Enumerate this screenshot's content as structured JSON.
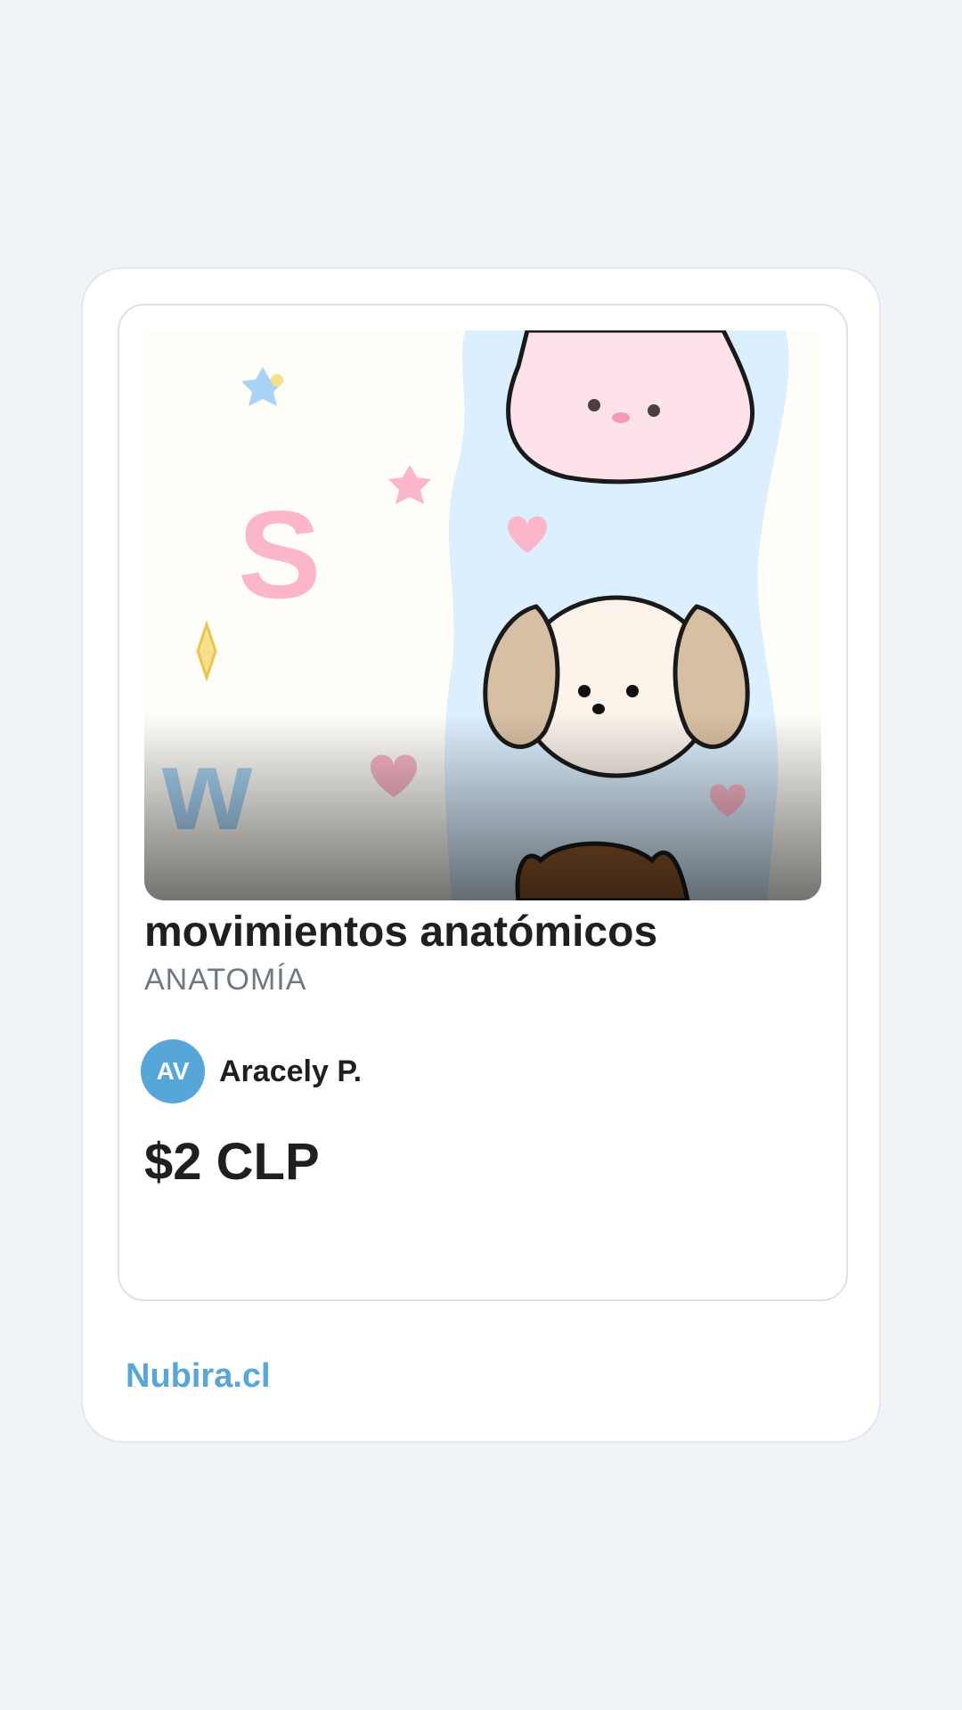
{
  "product": {
    "title": "movimientos anatómicos",
    "category": "ANATOMÍA",
    "price": "$2 CLP",
    "image_icon": "cute-animals-illustration"
  },
  "seller": {
    "initials": "AV",
    "name": "Aracely P."
  },
  "footer": {
    "brand": "Nubira.cl"
  },
  "colors": {
    "background": "#f0f4f8",
    "accent": "#56a6da",
    "text": "#1f1f1f",
    "muted": "#6f7882"
  }
}
